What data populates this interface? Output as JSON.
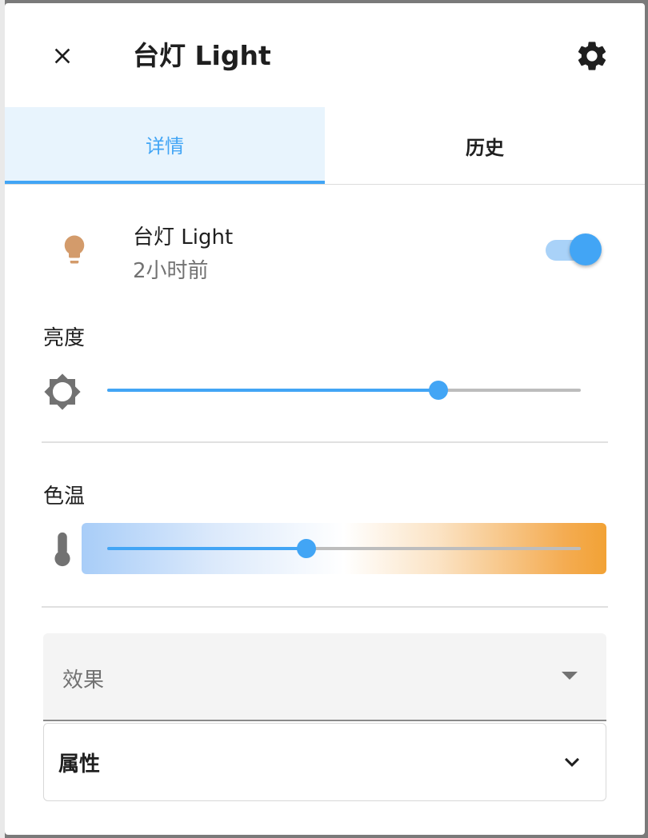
{
  "dialog": {
    "title": "台灯 Light"
  },
  "tabs": [
    {
      "label": "详情",
      "active": true
    },
    {
      "label": "历史",
      "active": false
    }
  ],
  "entity": {
    "name": "台灯 Light",
    "last_changed": "2小时前",
    "state_on": true,
    "icon": "lightbulb-icon",
    "icon_color": "#d39b6b"
  },
  "brightness": {
    "label": "亮度",
    "value_fraction": 0.7,
    "icon": "brightness-icon"
  },
  "color_temp": {
    "label": "色温",
    "value_fraction": 0.42,
    "icon": "thermometer-icon"
  },
  "effect": {
    "label": "效果"
  },
  "attributes": {
    "label": "属性"
  },
  "colors": {
    "accent": "#42a5f5",
    "accent_light": "#e8f4fd",
    "text": "#1f1f1f",
    "secondary_text": "#727272"
  }
}
